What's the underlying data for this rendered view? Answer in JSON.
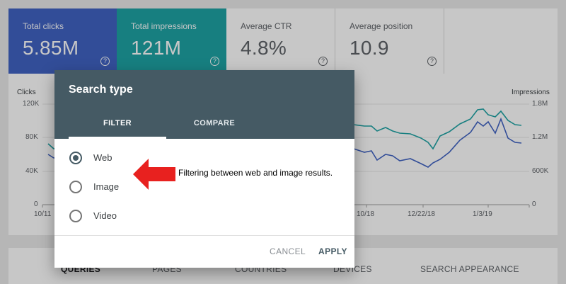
{
  "metrics": [
    {
      "label": "Total clicks",
      "value": "5.85M"
    },
    {
      "label": "Total impressions",
      "value": "121M"
    },
    {
      "label": "Average CTR",
      "value": "4.8%"
    },
    {
      "label": "Average position",
      "value": "10.9"
    }
  ],
  "help_glyph": "?",
  "chart": {
    "left_title": "Clicks",
    "right_title": "Impressions",
    "left_ticks": [
      "120K",
      "80K",
      "40K",
      "0"
    ],
    "right_ticks": [
      "1.8M",
      "1.2M",
      "600K",
      "0"
    ],
    "x_ticks": [
      "10/11",
      "10/18",
      "12/22/18",
      "1/3/19"
    ],
    "colors": {
      "clicks": "#4063c3",
      "impressions": "#1ea3a5"
    }
  },
  "bottom_tabs": [
    "QUERIES",
    "PAGES",
    "COUNTRIES",
    "DEVICES",
    "SEARCH APPEARANCE"
  ],
  "dialog": {
    "title": "Search type",
    "tabs": [
      "FILTER",
      "COMPARE"
    ],
    "options": [
      "Web",
      "Image",
      "Video"
    ],
    "selected_option": "Web",
    "cancel_label": "CANCEL",
    "apply_label": "APPLY",
    "header_color": "#455a64"
  },
  "annotation": {
    "text": "Filtering between web and image results.",
    "arrow_color": "#e8211f"
  }
}
